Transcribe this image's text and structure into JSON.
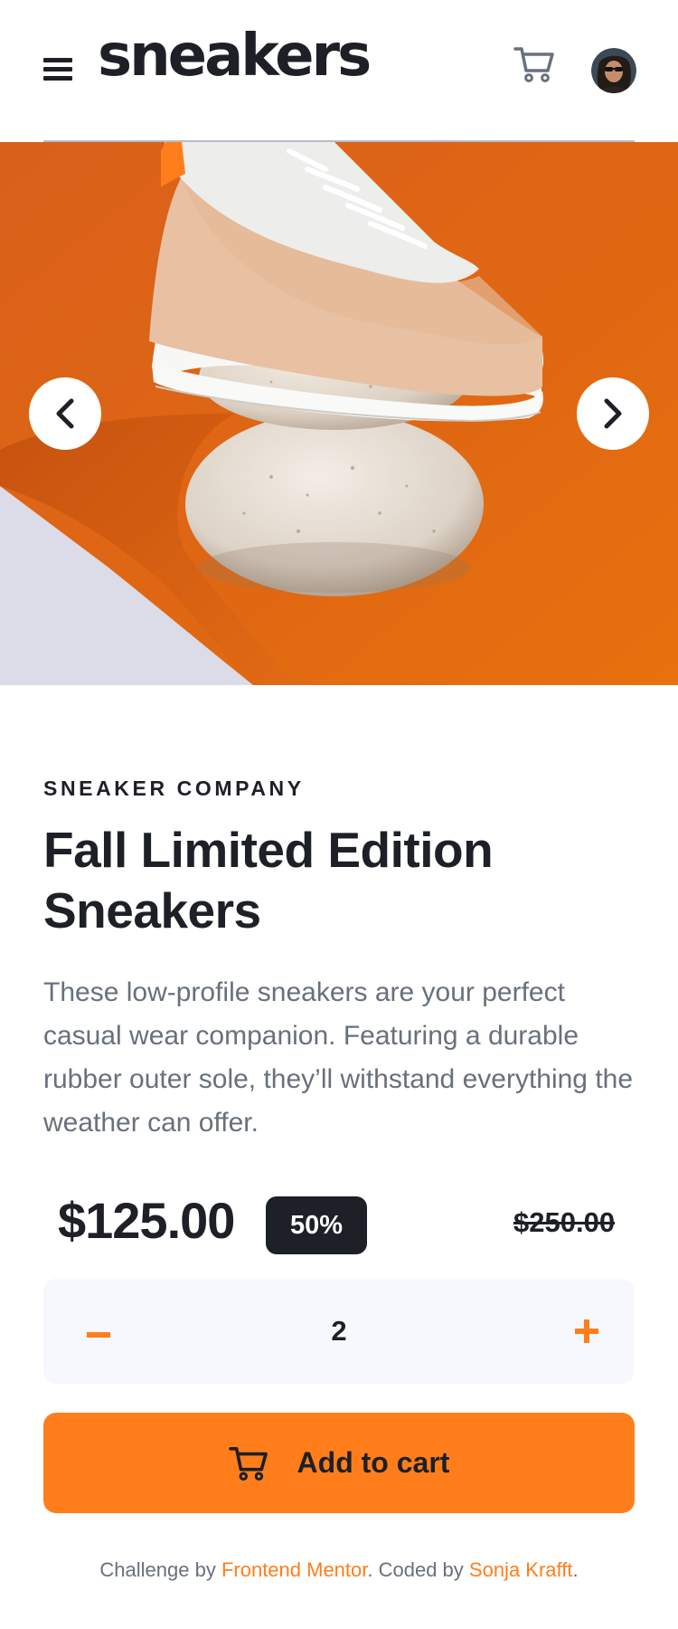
{
  "header": {
    "logo": "sneakers",
    "cart_label": "cart",
    "avatar_label": "user avatar"
  },
  "hero": {
    "prev_label": "previous image",
    "next_label": "next image"
  },
  "product": {
    "company": "SNEAKER COMPANY",
    "title": "Fall Limited Edition Sneakers",
    "description": "These low-profile sneakers are your perfect casual wear companion. Featuring a durable rubber outer sole, they’ll withstand everything the weather can offer.",
    "price": "$125.00",
    "discount": "50%",
    "original_price": "$250.00"
  },
  "quantity": {
    "value": "2"
  },
  "add_to_cart": {
    "label": "Add to cart"
  },
  "footer": {
    "prefix": "Challenge by ",
    "challenge_link": "Frontend Mentor",
    "middle": ". Coded by ",
    "author_link": "Sonja Krafft",
    "suffix": "."
  },
  "colors": {
    "accent": "#ff7e1b",
    "dark": "#1d2026",
    "muted": "#68707d",
    "stepper_bg": "#f6f8fd"
  },
  "icons": {
    "menu": "hamburger-menu-icon",
    "cart": "cart-icon",
    "prev": "chevron-left-icon",
    "next": "chevron-right-icon",
    "minus": "minus-icon",
    "plus": "plus-icon"
  }
}
